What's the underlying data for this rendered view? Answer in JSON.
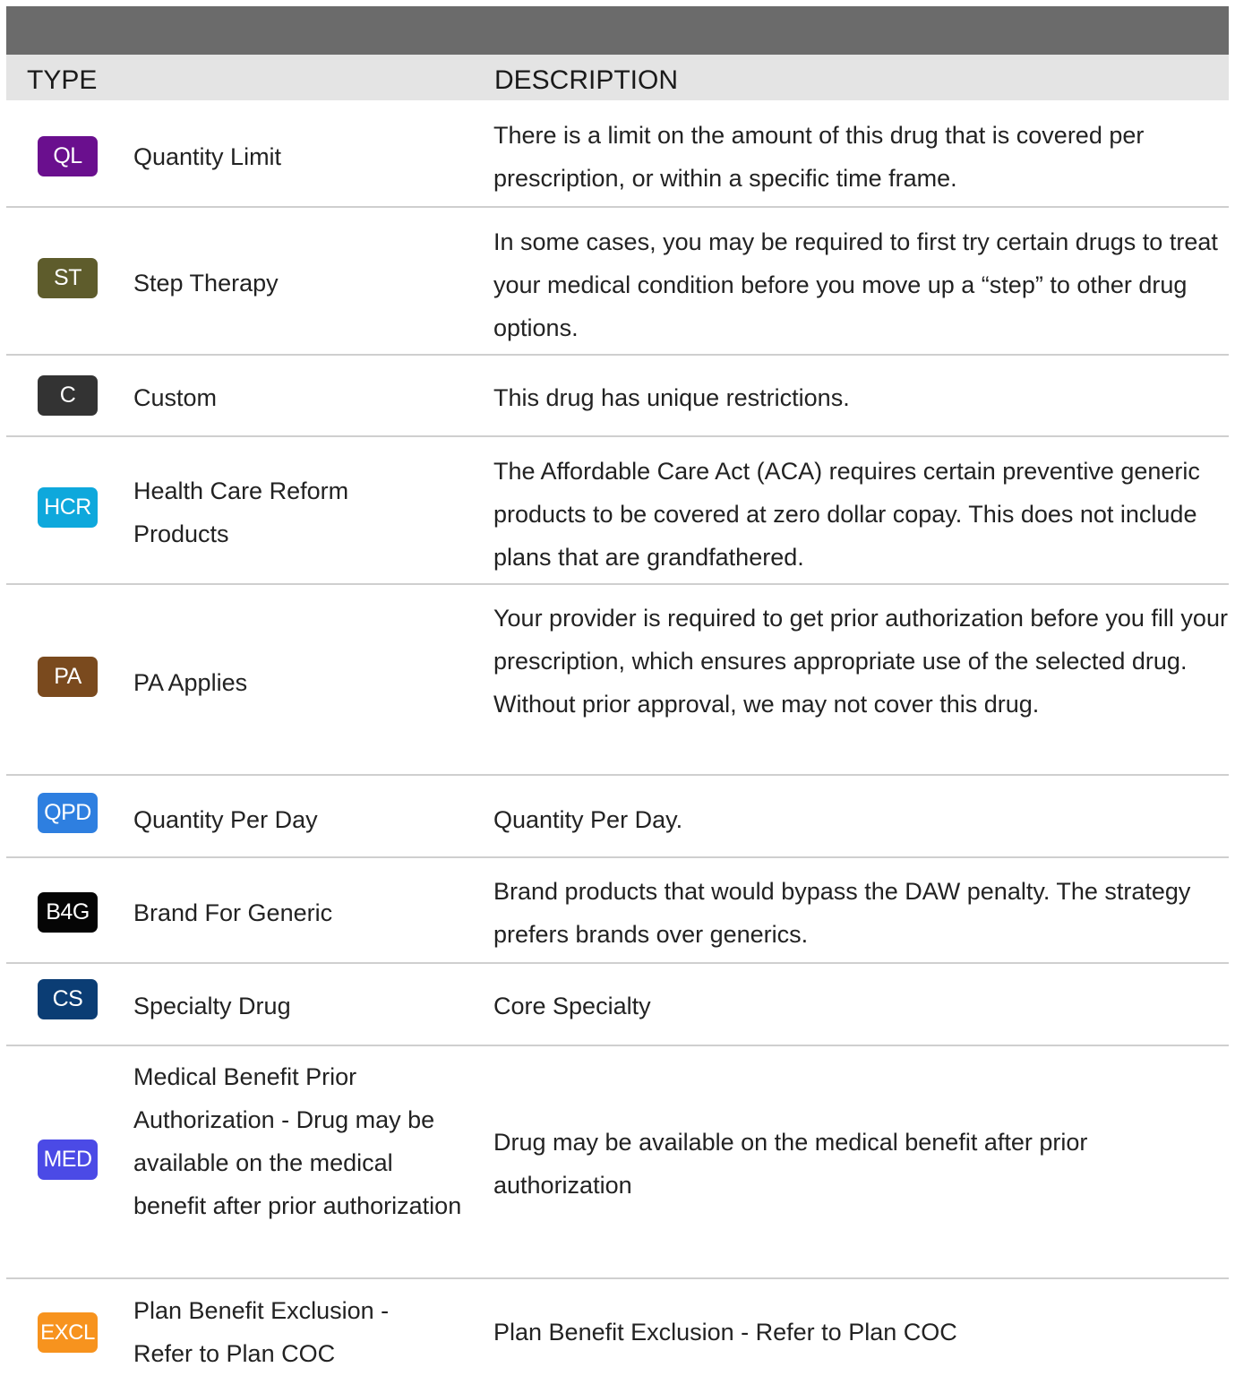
{
  "table": {
    "header": {
      "type": "TYPE",
      "description": "DESCRIPTION"
    },
    "rows": [
      {
        "badge": "QL",
        "badge_color": "#6a0f8e",
        "name": "Quantity Limit",
        "description": "There is a limit on the amount of this drug that is covered per prescription, or within a specific time frame."
      },
      {
        "badge": "ST",
        "badge_color": "#5e5c2c",
        "name": "Step Therapy",
        "description": "In some cases, you may be required to first try certain drugs to treat your medical condition before you move up a “step” to other drug options."
      },
      {
        "badge": "C",
        "badge_color": "#333333",
        "name": "Custom",
        "description": "This drug has unique restrictions."
      },
      {
        "badge": "HCR",
        "badge_color": "#0ea8dc",
        "name": "Health Care Reform Products",
        "description": "The Affordable Care Act (ACA) requires certain preventive generic products to be covered at zero dollar copay. This does not include plans that are grandfathered."
      },
      {
        "badge": "PA",
        "badge_color": "#7a4a1e",
        "name": "PA Applies",
        "description": "Your provider is required to get prior authorization before you fill your prescription, which ensures appropriate use of the selected drug. Without prior approval, we may not cover this drug."
      },
      {
        "badge": "QPD",
        "badge_color": "#2e7fe0",
        "name": "Quantity Per Day",
        "description": "Quantity Per Day."
      },
      {
        "badge": "B4G",
        "badge_color": "#050505",
        "name": "Brand For Generic",
        "description": "Brand products that would bypass the DAW penalty. The strategy prefers brands over generics."
      },
      {
        "badge": "CS",
        "badge_color": "#0b3d74",
        "name": "Specialty Drug",
        "description": "Core Specialty"
      },
      {
        "badge": "MED",
        "badge_color": "#4b4ae6",
        "name": "Medical Benefit Prior Authorization - Drug may be available on the medical benefit after prior authorization",
        "description": "Drug may be available on the medical benefit after prior authorization"
      },
      {
        "badge": "EXCL",
        "badge_color": "#f7931e",
        "name": "Plan Benefit Exclusion - Refer to Plan COC",
        "description": "Plan Benefit Exclusion - Refer to Plan COC"
      }
    ]
  }
}
